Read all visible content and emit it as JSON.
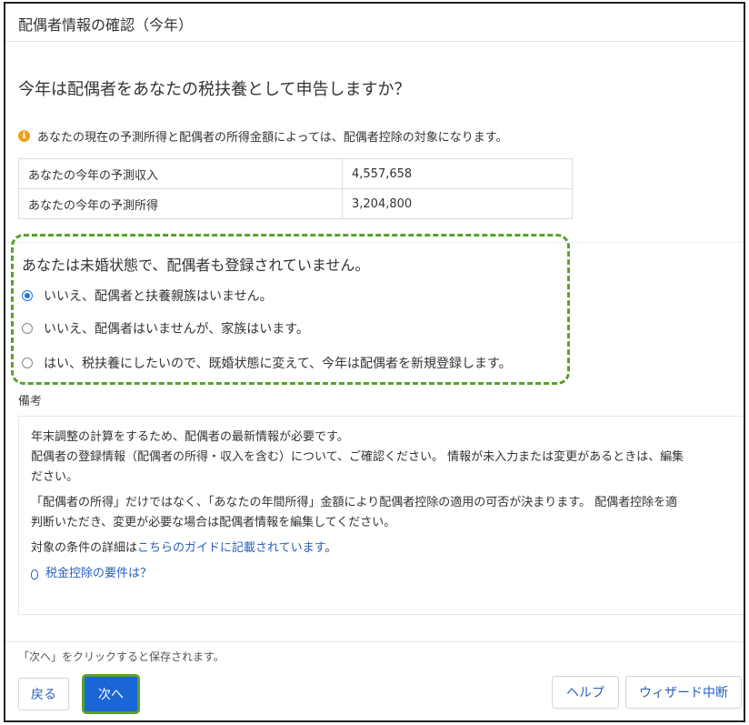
{
  "header": {
    "title": "配偶者情報の確認（今年）"
  },
  "question": "今年は配偶者をあなたの税扶養として申告しますか？",
  "info": {
    "icon": "info-icon",
    "text": "あなたの現在の予測所得と配偶者の所得金額によっては、配偶者控除の対象になります。"
  },
  "income_table": [
    {
      "label": "あなたの今年の予測収入",
      "value": "4,557,658"
    },
    {
      "label": "あなたの今年の予測所得",
      "value": "3,204,800"
    }
  ],
  "status_text": "あなたは未婚状態で、配偶者も登録されていません。",
  "options": [
    {
      "label": "いいえ、配偶者と扶養親族はいません。",
      "selected": true
    },
    {
      "label": "いいえ、配偶者はいませんが、家族はいます。",
      "selected": false
    },
    {
      "label": "はい、税扶養にしたいので、既婚状態に変えて、今年は配偶者を新規登録します。",
      "selected": false
    }
  ],
  "remarks": {
    "label": "備考",
    "line1": "年末調整の計算をするため、配偶者の最新情報が必要です。",
    "line2": "配偶者の登録情報（配偶者の所得・収入を含む）について、ご確認ください。 情報が未入力または変更があるときは、編集",
    "line3": "ださい。",
    "line4": "「配偶者の所得」だけではなく、「あなたの年間所得」金額により配偶者控除の適用の可否が決まります。 配偶者控除を適",
    "line5": "判断いただき、変更が必要な場合は配偶者情報を編集してください。",
    "guide_prefix": "対象の条件の詳細は",
    "guide_link": "こちらのガイドに記載されています",
    "guide_suffix": "。",
    "hint_icon": "lightbulb-icon",
    "hint_link": "税金控除の要件は？"
  },
  "footer": {
    "note": "「次へ」をクリックすると保存されます。",
    "back": "戻る",
    "next": "次へ",
    "help": "ヘルプ",
    "abort": "ウィザード中断"
  },
  "colors": {
    "accent": "#1a66d6",
    "highlight": "#5aa02c",
    "info": "#e8a317",
    "link": "#2a5fbd"
  }
}
